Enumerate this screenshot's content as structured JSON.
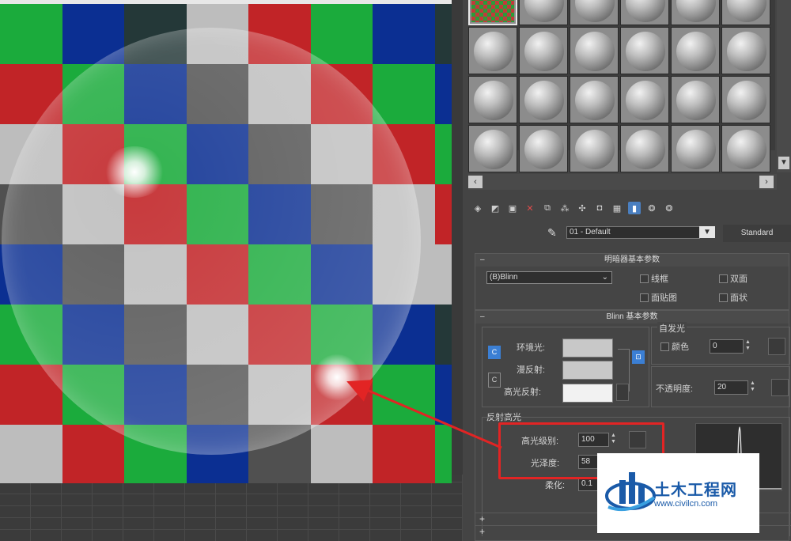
{
  "viewport": {
    "checker_colors": [
      [
        "#1bab3c",
        "#0b2f92",
        "#243838",
        "#bdbdbd",
        "#c12427",
        "#1bab3c",
        "#0b2f92",
        "#243838"
      ],
      [
        "#c12427",
        "#1bab3c",
        "#0b2f92",
        "#505050",
        "#bdbdbd",
        "#c12427",
        "#1bab3c",
        "#0b2f92"
      ],
      [
        "#bdbdbd",
        "#c12427",
        "#1bab3c",
        "#0b2f92",
        "#505050",
        "#bdbdbd",
        "#c12427",
        "#1bab3c"
      ],
      [
        "#505050",
        "#bdbdbd",
        "#c12427",
        "#1bab3c",
        "#0b2f92",
        "#505050",
        "#bdbdbd",
        "#c12427"
      ],
      [
        "#0b2f92",
        "#505050",
        "#bdbdbd",
        "#c12427",
        "#1bab3c",
        "#0b2f92",
        "#bdbdbd",
        "#bdbdbd"
      ],
      [
        "#1bab3c",
        "#0b2f92",
        "#505050",
        "#bdbdbd",
        "#c12427",
        "#1bab3c",
        "#0b2f92",
        "#243838"
      ],
      [
        "#c12427",
        "#1bab3c",
        "#0b2f92",
        "#505050",
        "#bdbdbd",
        "#c12427",
        "#1bab3c",
        "#0b2f92"
      ],
      [
        "#bdbdbd",
        "#c12427",
        "#1bab3c",
        "#0b2f92",
        "#505050",
        "#bdbdbd",
        "#c12427",
        "#1bab3c"
      ]
    ]
  },
  "toolbar": {
    "icons": [
      "get-material-icon",
      "put-to-scene-icon",
      "assign-icon",
      "delete-icon",
      "make-copy-icon",
      "unique-icon",
      "put-library-icon",
      "material-id-icon",
      "show-map-icon",
      "show-end-result-icon",
      "go-parent-icon",
      "go-sibling-icon"
    ]
  },
  "material": {
    "name": "01 - Default",
    "type": "Standard",
    "dropdown_arrow": "▼"
  },
  "shader_basic": {
    "title": "明暗器基本参数",
    "toggle": "–",
    "shader": "(B)Blinn",
    "wire": "线框",
    "two_sided": "双面",
    "face_map": "面贴图",
    "faceted": "面状"
  },
  "blinn_basic": {
    "title": "Blinn 基本参数",
    "toggle": "–",
    "ambient": "环境光:",
    "diffuse": "漫反射:",
    "specular": "高光反射:",
    "self_illum_title": "自发光",
    "color_label": "颜色",
    "color_value": "0",
    "opacity_label": "不透明度:",
    "opacity_value": "20",
    "lock_glyph": "🔒",
    "c_glyph": "C",
    "swatch_ambient": "#c8c8c8",
    "swatch_diffuse": "#c8c8c8",
    "swatch_specular": "#f2f2f2"
  },
  "specular_highlights": {
    "title": "反射高光",
    "level_label": "高光级别:",
    "level_value": "100",
    "gloss_label": "光泽度:",
    "gloss_value": "58",
    "soften_label": "柔化:",
    "soften_value": "0.1"
  },
  "rollouts_collapsed": [
    "+",
    "+"
  ],
  "watermark": {
    "cn": "土木工程网",
    "url": "www.civilcn.com"
  },
  "colors": {
    "annotation_red": "#e22424",
    "accent_blue": "#3b7fd4"
  }
}
